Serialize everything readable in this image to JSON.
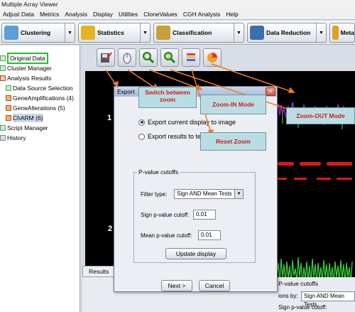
{
  "window": {
    "title": "Multiple Array Viewer"
  },
  "menu": [
    "Adjust Data",
    "Metrics",
    "Analysis",
    "Display",
    "Utilities",
    "CloneValues",
    "CGH Analysis",
    "Help"
  ],
  "toolbar": {
    "clustering": "Clustering",
    "statistics": "Statistics",
    "classification": "Classification",
    "data_reduction": "Data Reduction",
    "meta": "Meta"
  },
  "tree": {
    "original_data": "Original Data",
    "cluster_manager": "Cluster Manager",
    "analysis_results": "Analysis Results",
    "data_source_selection": "Data Source Selection",
    "gene_amplifications": "GeneAmplifications (4)",
    "gene_alterations": "GeneAlterations (5)",
    "charm": "ChARM (6)",
    "script_manager": "Script Manager",
    "history": "History"
  },
  "plot": {
    "row1": "1",
    "row2": "2"
  },
  "results_tab": "Results",
  "dialog": {
    "title": "Export",
    "radio1": "Export current display to image",
    "radio2": "Export results to tex",
    "group_title": "P-value cutoffs",
    "filter_label": "Filter type:",
    "filter_value": "Sign AND Mean Tests",
    "sign_label": "Sign p-value cutoff:",
    "sign_value": "0.01",
    "mean_label": "Mean  p-value cutoff:",
    "mean_value": "0.01",
    "update_button": "Update display",
    "next_button": "Next >",
    "cancel_button": "Cancel"
  },
  "callouts": {
    "switch_zoom": "Switch between zoom",
    "zoom_in": "Zoom-IN  Mode",
    "zoom_out": "Zoom-OUT  Mode",
    "reset_zoom": "Reset Zoom"
  },
  "right_panel": {
    "title": "P-value cutoffs",
    "filter_label": "ions by:",
    "filter_value": "Sign AND Mean Tests",
    "sign_label": "Sign p-value cutoff:"
  }
}
